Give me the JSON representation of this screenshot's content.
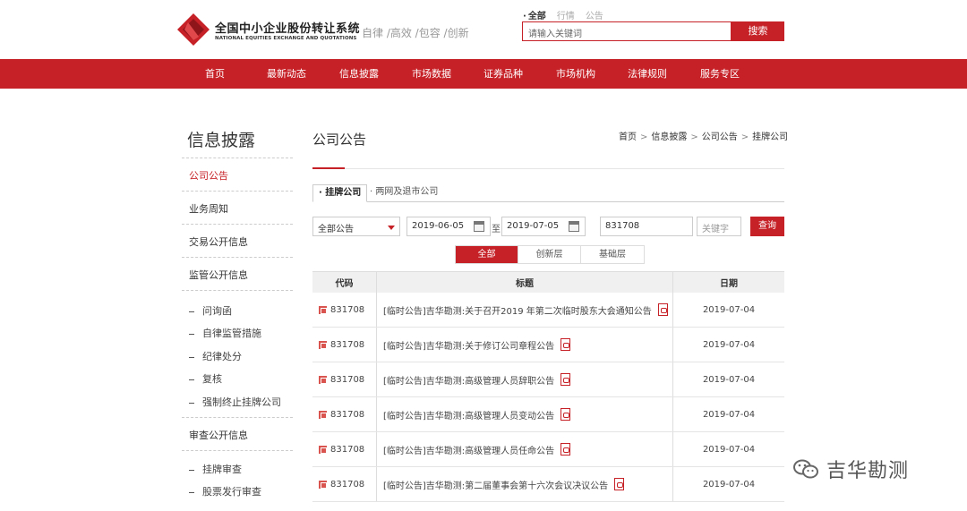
{
  "header": {
    "logo_cn": "全国中小企业股份转让系统",
    "logo_en": "NATIONAL EQUITIES EXCHANGE AND QUOTATIONS",
    "slogan": "自律 /高效 /包容 /创新",
    "search_tabs": [
      "全部",
      "行情",
      "公告"
    ],
    "search_placeholder": "请输入关键词",
    "search_button": "搜索"
  },
  "nav": [
    "首页",
    "最新动态",
    "信息披露",
    "市场数据",
    "证券品种",
    "市场机构",
    "法律规则",
    "服务专区"
  ],
  "sidebar": {
    "title": "信息披露",
    "items": [
      "公司公告",
      "业务周知",
      "交易公开信息",
      "监管公开信息"
    ],
    "jianguan_sub": [
      "问询函",
      "自律监管措施",
      "纪律处分",
      "复核",
      "强制终止挂牌公司"
    ],
    "shencha_title": "审查公开信息",
    "shencha_sub": [
      "挂牌审查",
      "股票发行审查"
    ]
  },
  "main": {
    "title": "公司公告",
    "breadcrumb": [
      "首页",
      "信息披露",
      "公司公告",
      "挂牌公司"
    ],
    "subtabs": [
      "· 挂牌公司",
      "· 两网及退市公司"
    ],
    "filters": {
      "type": "全部公告",
      "start_date": "2019-06-05",
      "to": "至",
      "end_date": "2019-07-05",
      "code": "831708",
      "keyword_placeholder": "关键字",
      "query_button": "查询"
    },
    "layer_tabs": [
      "全部",
      "创新层",
      "基础层"
    ],
    "table": {
      "headers": [
        "代码",
        "标题",
        "日期"
      ],
      "rows": [
        {
          "code": "831708",
          "title": "[临时公告]吉华勘测:关于召开2019 年第二次临时股东大会通知公告",
          "date": "2019-07-04"
        },
        {
          "code": "831708",
          "title": "[临时公告]吉华勘测:关于修订公司章程公告",
          "date": "2019-07-04"
        },
        {
          "code": "831708",
          "title": "[临时公告]吉华勘测:高级管理人员辞职公告",
          "date": "2019-07-04"
        },
        {
          "code": "831708",
          "title": "[临时公告]吉华勘测:高级管理人员变动公告",
          "date": "2019-07-04"
        },
        {
          "code": "831708",
          "title": "[临时公告]吉华勘测:高级管理人员任命公告",
          "date": "2019-07-04"
        },
        {
          "code": "831708",
          "title": "[临时公告]吉华勘测:第二届董事会第十六次会议决议公告",
          "date": "2019-07-04"
        }
      ]
    }
  },
  "watermark": "吉华勘测",
  "colors": {
    "brand_red": "#c62127"
  }
}
